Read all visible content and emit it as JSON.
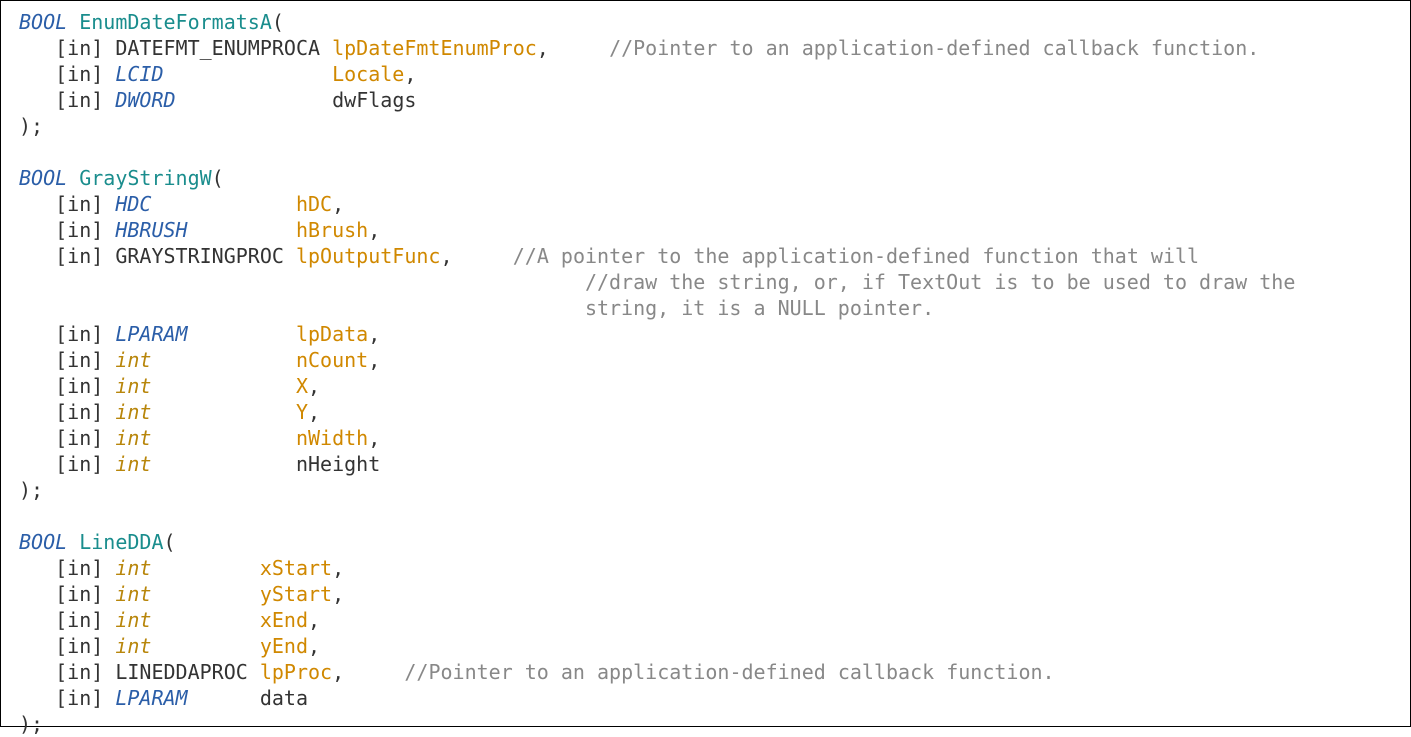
{
  "tokens": {
    "BOOL": "BOOL",
    "in": "[in]",
    "close": ");"
  },
  "func1": {
    "name": "EnumDateFormatsA",
    "p1_type": "DATEFMT_ENUMPROCA",
    "p1_name": "lpDateFmtEnumProc",
    "p1_comment": "//Pointer to an application-defined callback function.",
    "p2_type": "LCID",
    "p2_name": "Locale",
    "p3_type": "DWORD",
    "p3_name": "dwFlags"
  },
  "func2": {
    "name": "GrayStringW",
    "p1_type": "HDC",
    "p1_name": "hDC",
    "p2_type": "HBRUSH",
    "p2_name": "hBrush",
    "p3_type": "GRAYSTRINGPROC",
    "p3_name": "lpOutputFunc",
    "p3_comment1": "//A pointer to the application-defined function that will",
    "p3_comment2": "//draw the string, or, if TextOut is to be used to draw the",
    "p3_comment3": "string, it is a NULL pointer.",
    "p4_type": "LPARAM",
    "p4_name": "lpData",
    "p5_type": "int",
    "p5_name": "nCount",
    "p6_type": "int",
    "p6_name": "X",
    "p7_type": "int",
    "p7_name": "Y",
    "p8_type": "int",
    "p8_name": "nWidth",
    "p9_type": "int",
    "p9_name": "nHeight"
  },
  "func3": {
    "name": "LineDDA",
    "p1_type": "int",
    "p1_name": "xStart",
    "p2_type": "int",
    "p2_name": "yStart",
    "p3_type": "int",
    "p3_name": "xEnd",
    "p4_type": "int",
    "p4_name": "yEnd",
    "p5_type": "LINEDDAPROC",
    "p5_name": "lpProc",
    "p5_comment": "//Pointer to an application-defined callback function.",
    "p6_type": "LPARAM",
    "p6_name": "data"
  }
}
